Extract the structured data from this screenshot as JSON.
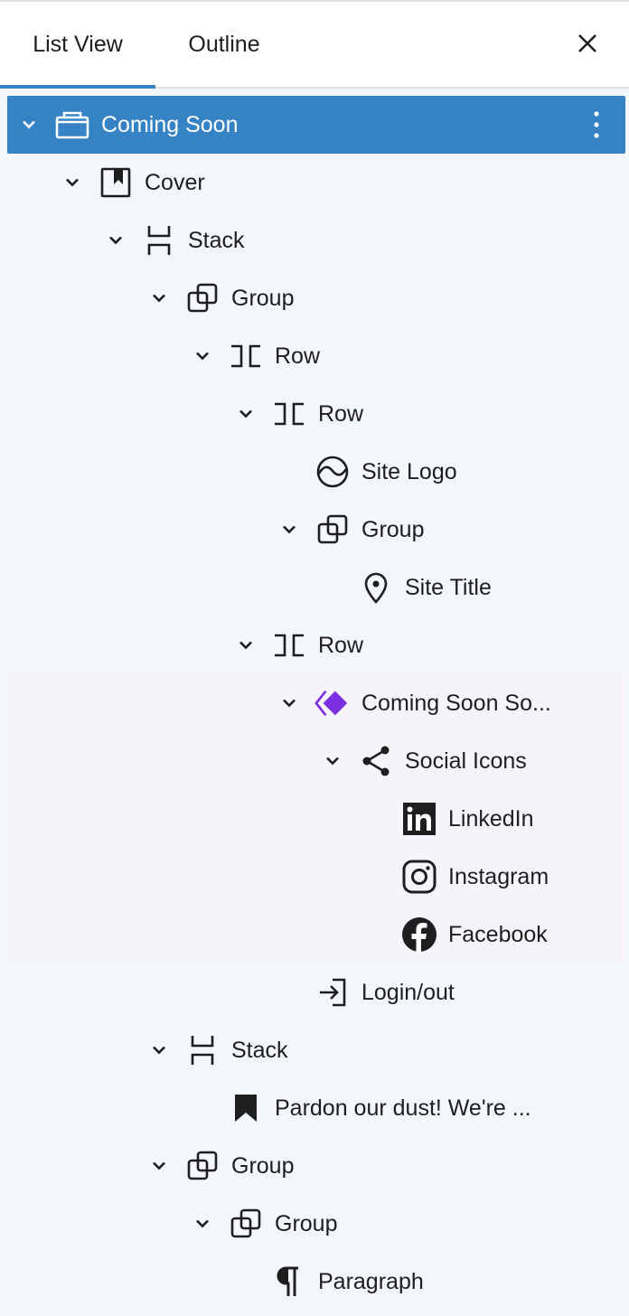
{
  "tabs": [
    {
      "label": "List View",
      "active": true
    },
    {
      "label": "Outline",
      "active": false
    }
  ],
  "close_icon": "close-icon",
  "accent_color": "#3582c4",
  "tree": [
    {
      "label": "Coming Soon",
      "icon": "template-part-icon",
      "depth": 0,
      "expanded": true,
      "selected": true
    },
    {
      "label": "Cover",
      "icon": "cover-icon",
      "depth": 1,
      "expanded": true
    },
    {
      "label": "Stack",
      "icon": "stack-icon",
      "depth": 2,
      "expanded": true
    },
    {
      "label": "Group",
      "icon": "group-icon",
      "depth": 3,
      "expanded": true
    },
    {
      "label": "Row",
      "icon": "row-icon",
      "depth": 4,
      "expanded": true
    },
    {
      "label": "Row",
      "icon": "row-icon",
      "depth": 5,
      "expanded": true
    },
    {
      "label": "Site Logo",
      "icon": "site-logo-icon",
      "depth": 6
    },
    {
      "label": "Group",
      "icon": "group-icon",
      "depth": 6,
      "expanded": true
    },
    {
      "label": "Site Title",
      "icon": "map-marker-icon",
      "depth": 7
    },
    {
      "label": "Row",
      "icon": "row-icon",
      "depth": 5,
      "expanded": true
    },
    {
      "label": "Coming Soon So...",
      "icon": "plugin-diamond-icon",
      "depth": 6,
      "expanded": true,
      "tint": true
    },
    {
      "label": "Social Icons",
      "icon": "share-icon",
      "depth": 7,
      "expanded": true,
      "tint": true
    },
    {
      "label": "LinkedIn",
      "icon": "linkedin-icon",
      "depth": 8,
      "tint": true
    },
    {
      "label": "Instagram",
      "icon": "instagram-icon",
      "depth": 8,
      "tint": true
    },
    {
      "label": "Facebook",
      "icon": "facebook-icon",
      "depth": 8,
      "tint": true
    },
    {
      "label": "Login/out",
      "icon": "login-icon",
      "depth": 6
    },
    {
      "label": "Stack",
      "icon": "stack-icon",
      "depth": 3,
      "expanded": true
    },
    {
      "label": "Pardon our dust! We're ...",
      "icon": "bookmark-icon",
      "depth": 4
    },
    {
      "label": "Group",
      "icon": "group-icon",
      "depth": 3,
      "expanded": true
    },
    {
      "label": "Group",
      "icon": "group-icon",
      "depth": 4,
      "expanded": true
    },
    {
      "label": "Paragraph",
      "icon": "paragraph-icon",
      "depth": 5
    }
  ],
  "options_icon": "more-vertical-icon"
}
